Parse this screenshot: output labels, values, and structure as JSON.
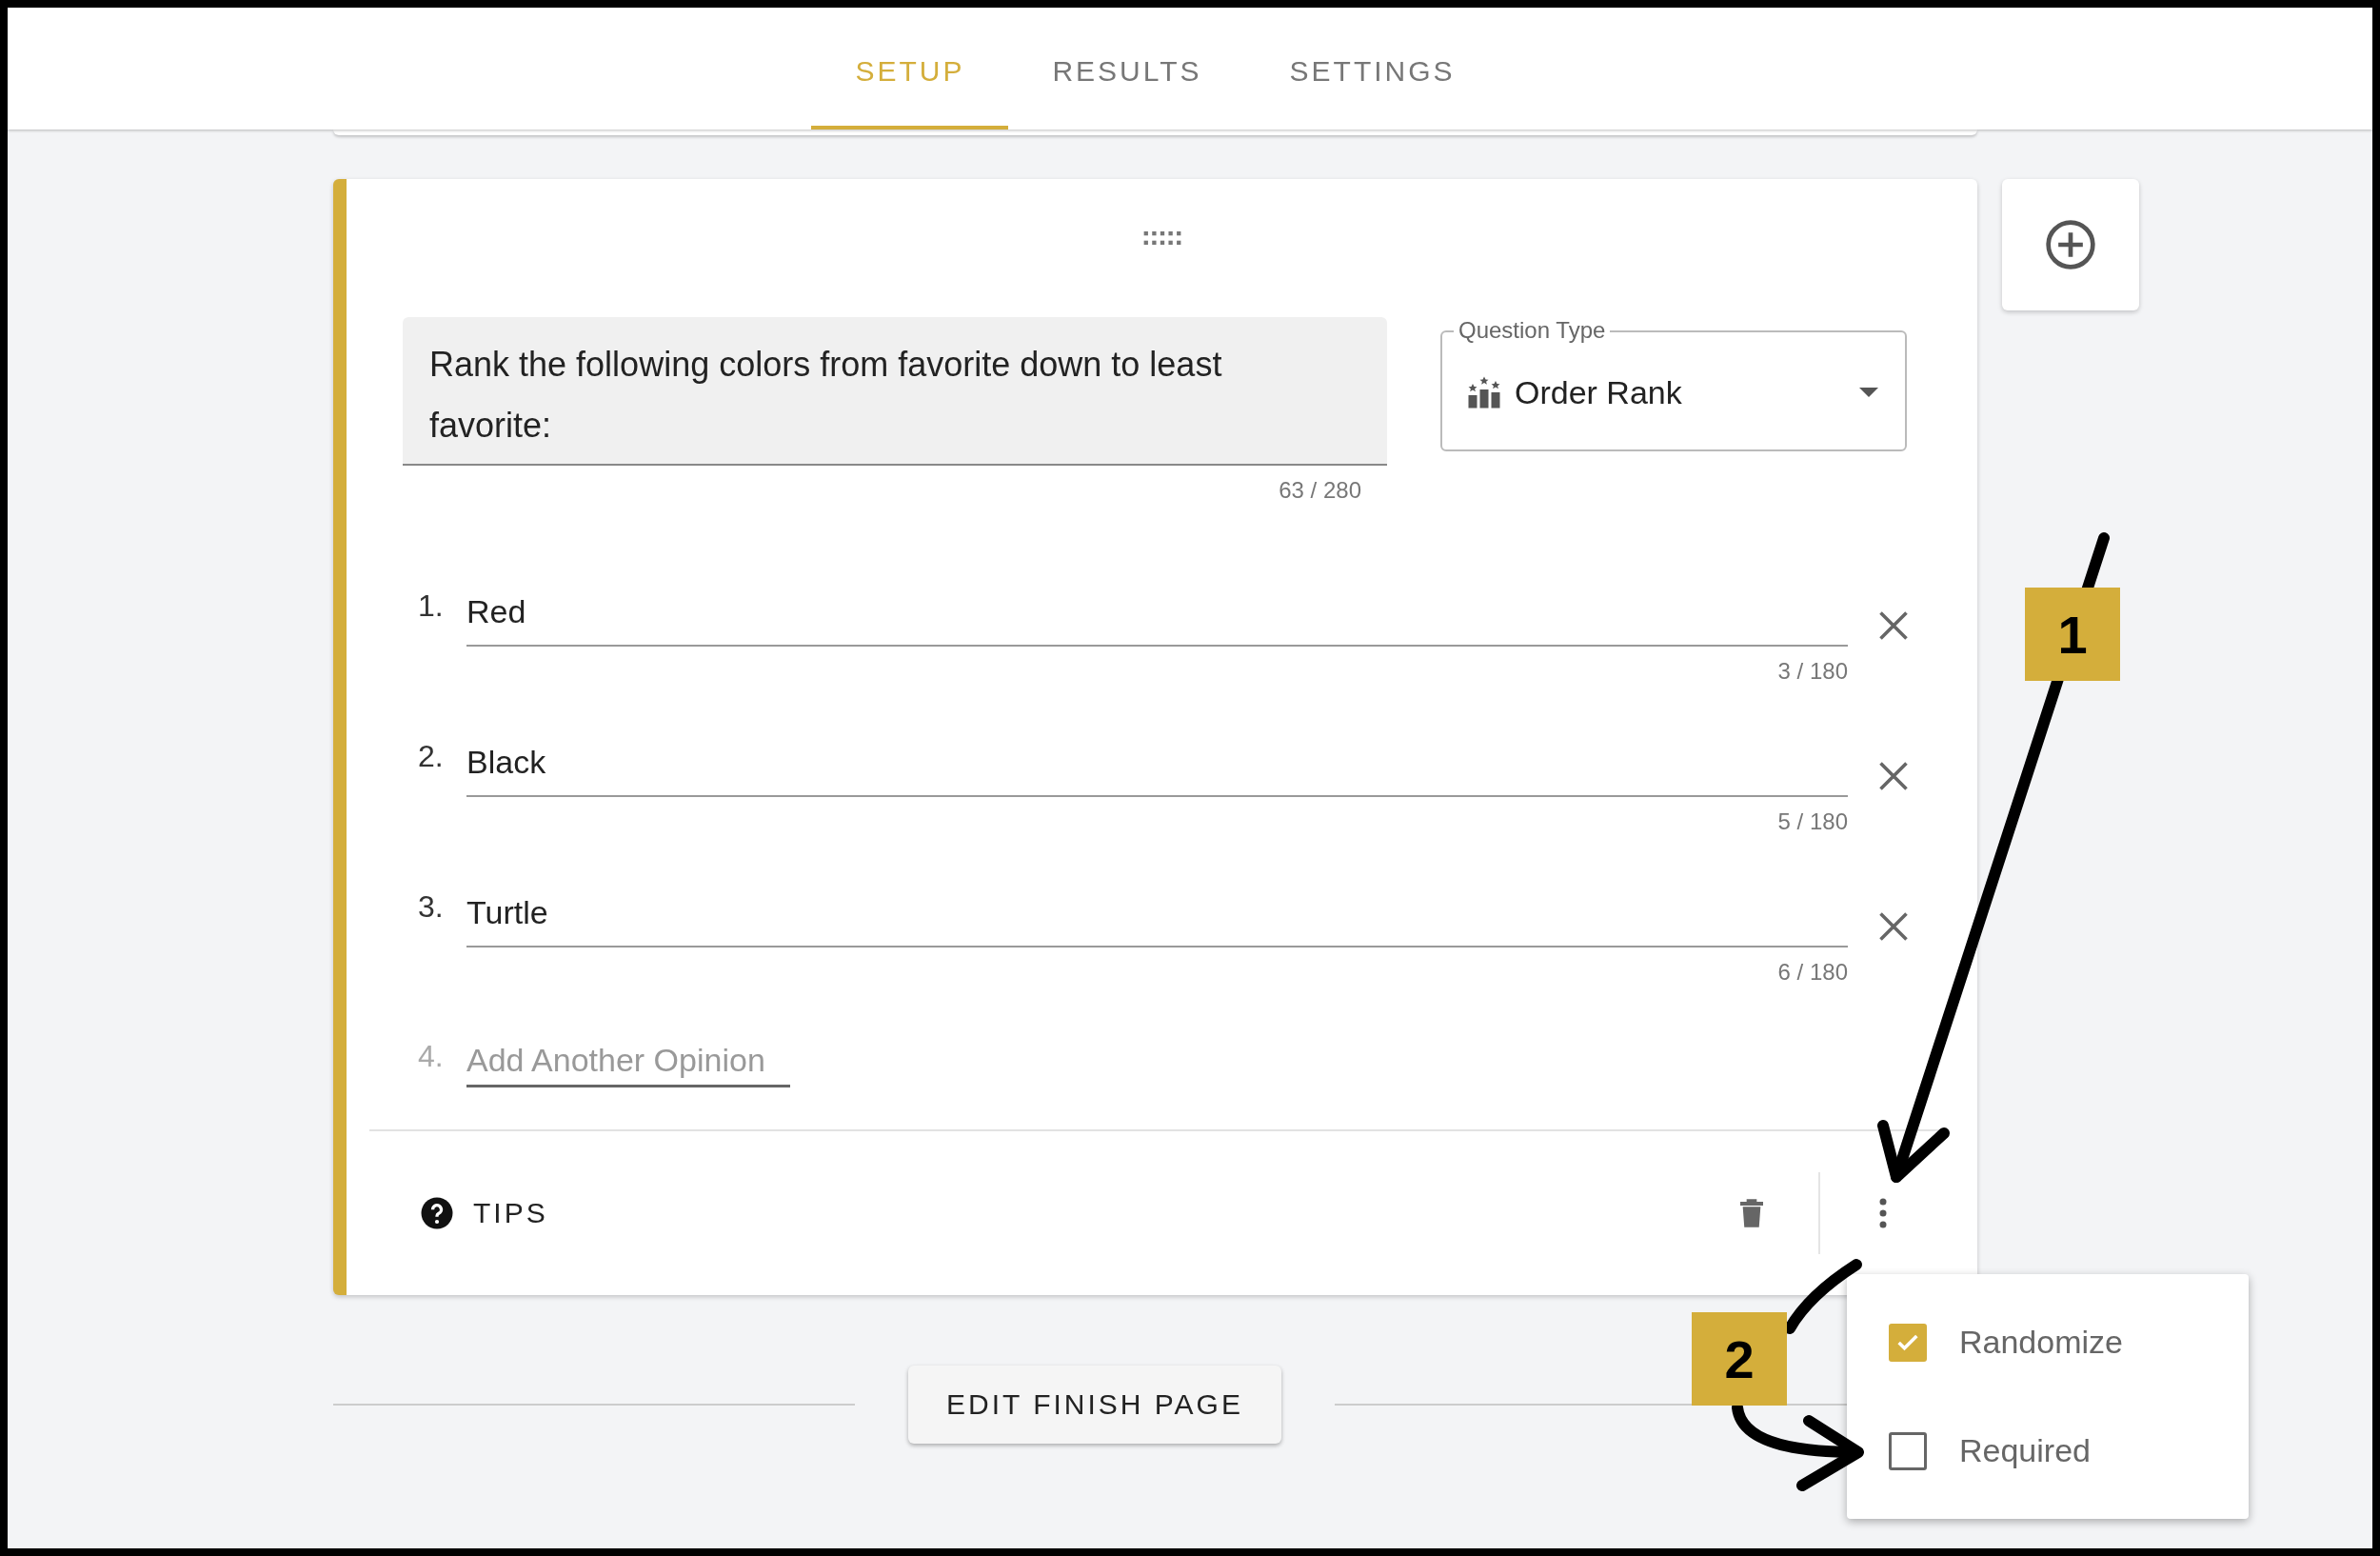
{
  "tabs": [
    {
      "label": "SETUP",
      "selected": true
    },
    {
      "label": "RESULTS",
      "selected": false
    },
    {
      "label": "SETTINGS",
      "selected": false
    }
  ],
  "question": {
    "text": "Rank the following colors from favorite down to least favorite:",
    "counter": "63 / 280"
  },
  "question_type": {
    "label": "Question Type",
    "value": "Order Rank"
  },
  "options": [
    {
      "number": "1.",
      "value": "Red",
      "counter": "3 / 180"
    },
    {
      "number": "2.",
      "value": "Black",
      "counter": "5 / 180"
    },
    {
      "number": "3.",
      "value": "Turtle",
      "counter": "6 / 180"
    }
  ],
  "new_option": {
    "number": "4.",
    "placeholder": "Add Another Opinion"
  },
  "footer": {
    "tips": "TIPS"
  },
  "menu": {
    "items": [
      {
        "label": "Randomize",
        "checked": true
      },
      {
        "label": "Required",
        "checked": false
      }
    ]
  },
  "finish_button": "EDIT FINISH PAGE",
  "callouts": [
    {
      "label": "1"
    },
    {
      "label": "2"
    }
  ]
}
